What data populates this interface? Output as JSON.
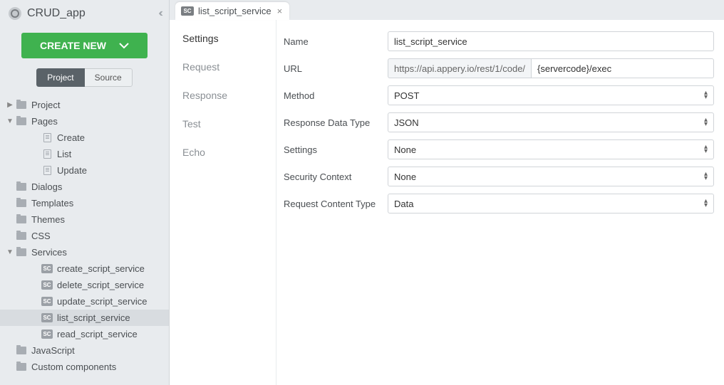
{
  "app_name": "CRUD_app",
  "create_new_label": "CREATE NEW",
  "toggle": {
    "project": "Project",
    "source": "Source"
  },
  "tree": {
    "project": "Project",
    "pages": "Pages",
    "create": "Create",
    "list": "List",
    "update": "Update",
    "dialogs": "Dialogs",
    "templates": "Templates",
    "themes": "Themes",
    "css": "CSS",
    "services": "Services",
    "create_script": "create_script_service",
    "delete_script": "delete_script_service",
    "update_script": "update_script_service",
    "list_script": "list_script_service",
    "read_script": "read_script_service",
    "javascript": "JavaScript",
    "custom_components": "Custom components"
  },
  "tab": {
    "badge": "SC",
    "title": "list_script_service"
  },
  "subnav": {
    "settings": "Settings",
    "request": "Request",
    "response": "Response",
    "test": "Test",
    "echo": "Echo"
  },
  "form": {
    "name_label": "Name",
    "name_value": "list_script_service",
    "url_label": "URL",
    "url_prefix": "https://api.appery.io/rest/1/code/",
    "url_value": "{servercode}/exec",
    "method_label": "Method",
    "method_value": "POST",
    "response_type_label": "Response Data Type",
    "response_type_value": "JSON",
    "settings_label": "Settings",
    "settings_value": "None",
    "security_label": "Security Context",
    "security_value": "None",
    "request_type_label": "Request Content Type",
    "request_type_value": "Data"
  },
  "sc_badge": "SC"
}
